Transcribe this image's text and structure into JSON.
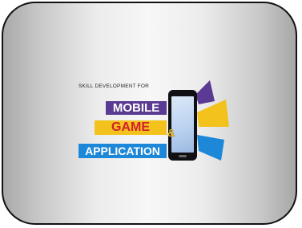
{
  "logo": {
    "tagline": "SKILL DEVELOPMENT FOR",
    "line1": "MOBILE",
    "line2": "GAME",
    "ampersand": "&",
    "line3": "APPLICATION"
  },
  "colors": {
    "purple": "#5a3a92",
    "yellow": "#f3c21c",
    "red": "#d21f2e",
    "blue": "#1e88d8"
  },
  "icons": [
    "phone-icon",
    "color-shards-icon"
  ]
}
